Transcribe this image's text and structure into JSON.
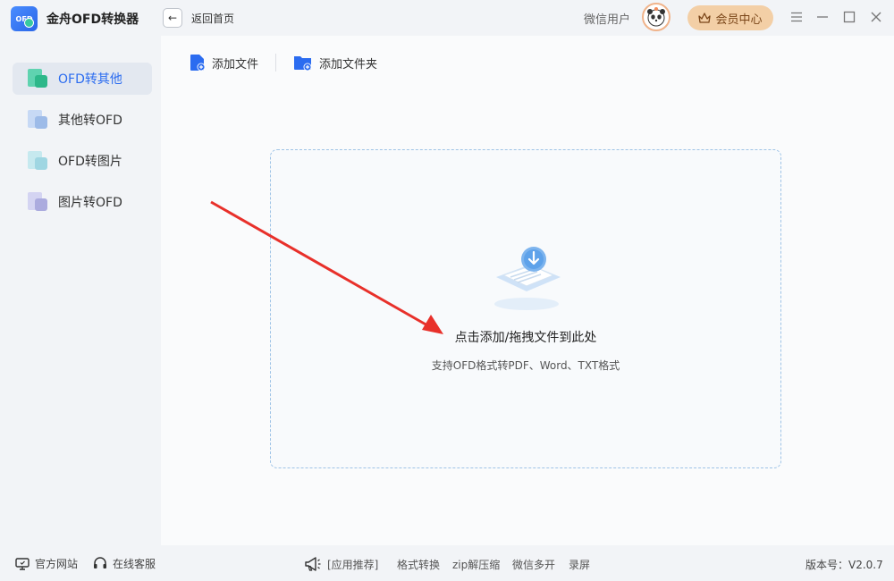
{
  "app": {
    "title": "金舟OFD转换器",
    "logo_text": "OFD",
    "back_label": "返回首页"
  },
  "user": {
    "name": "微信用户",
    "vip_label": "会员中心"
  },
  "sidebar": {
    "items": [
      {
        "label": "OFD转其他",
        "active": true
      },
      {
        "label": "其他转OFD",
        "active": false
      },
      {
        "label": "OFD转图片",
        "active": false
      },
      {
        "label": "图片转OFD",
        "active": false
      }
    ]
  },
  "toolbar": {
    "add_file": "添加文件",
    "add_folder": "添加文件夹"
  },
  "dropzone": {
    "title": "点击添加/拖拽文件到此处",
    "subtitle": "支持OFD格式转PDF、Word、TXT格式"
  },
  "footer": {
    "website": "官方网站",
    "support": "在线客服",
    "recommend": "[应用推荐]",
    "links": [
      "格式转换",
      "zip解压缩",
      "微信多开",
      "录屏"
    ],
    "version": "版本号：V2.0.7"
  },
  "colors": {
    "accent": "#2b6cf0",
    "vip_bg": "#f3cfa6",
    "arrow": "#e8302a"
  }
}
